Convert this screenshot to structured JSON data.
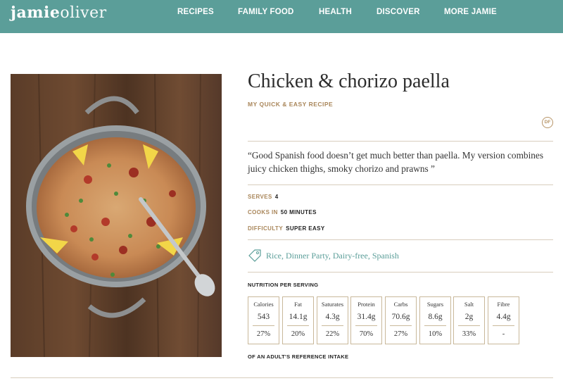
{
  "header": {
    "logo_bold": "jamie",
    "logo_light": "oliver",
    "nav": [
      "RECIPES",
      "FAMILY FOOD",
      "HEALTH",
      "DISCOVER",
      "MORE JAMIE"
    ]
  },
  "recipe": {
    "title": "Chicken & chorizo paella",
    "subtitle": "MY QUICK & EASY RECIPE",
    "badge": "DF",
    "quote": "“Good Spanish food doesn’t get much better than paella. My version combines juicy chicken thighs, smoky chorizo and prawns ”",
    "serves_label": "SERVES",
    "serves_value": "4",
    "cooks_label": "COOKS IN",
    "cooks_value": "50 MINUTES",
    "difficulty_label": "DIFFICULTY",
    "difficulty_value": "SUPER EASY",
    "tags": [
      "Rice",
      "Dinner Party",
      "Dairy-free",
      "Spanish"
    ]
  },
  "nutrition": {
    "heading": "NUTRITION PER SERVING",
    "items": [
      {
        "label": "Calories",
        "value": "543",
        "percent": "27%"
      },
      {
        "label": "Fat",
        "value": "14.1g",
        "percent": "20%"
      },
      {
        "label": "Saturates",
        "value": "4.3g",
        "percent": "22%"
      },
      {
        "label": "Protein",
        "value": "31.4g",
        "percent": "70%"
      },
      {
        "label": "Carbs",
        "value": "70.6g",
        "percent": "27%"
      },
      {
        "label": "Sugars",
        "value": "8.6g",
        "percent": "10%"
      },
      {
        "label": "Salt",
        "value": "2g",
        "percent": "33%"
      },
      {
        "label": "Fibre",
        "value": "4.4g",
        "percent": "-"
      }
    ],
    "footer": "OF AN ADULT'S REFERENCE INTAKE"
  },
  "colors": {
    "header_bg": "#5b9e99",
    "accent_gold": "#a9865a",
    "tag_teal": "#5b9e99"
  }
}
